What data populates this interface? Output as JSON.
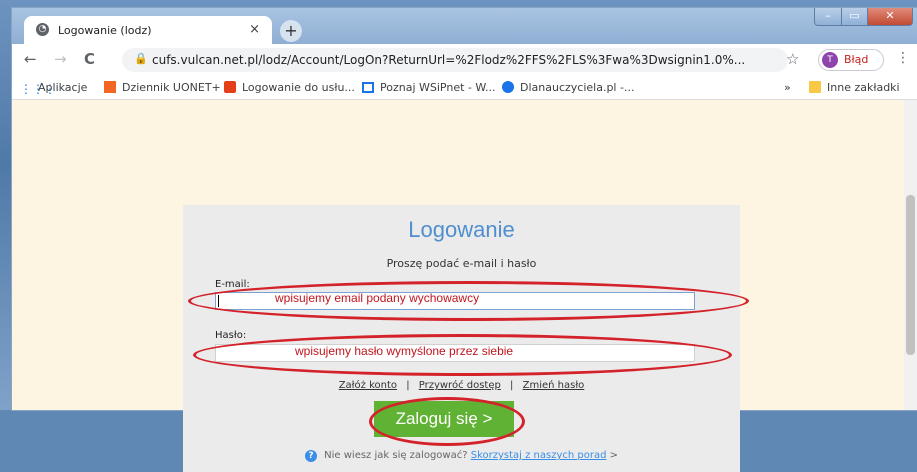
{
  "tab": {
    "title": "Logowanie (lodz)",
    "close": "×",
    "new": "+"
  },
  "window": {
    "min": "–",
    "max": "▭",
    "close": "✕"
  },
  "nav": {
    "back": "←",
    "forward": "→",
    "reload": "C"
  },
  "address": {
    "url": "cufs.vulcan.net.pl/lodz/Account/LogOn?ReturnUrl=%2Flodz%2FFS%2FLS%3Fwa%3Dwsignin1.0%..."
  },
  "profile": {
    "initial": "T",
    "label": "Błąd"
  },
  "bookmarks": {
    "items": [
      {
        "label": "Aplikacje",
        "icon": "apps-grid-icon"
      },
      {
        "label": "Dziennik UONET+",
        "icon": "uonet-icon"
      },
      {
        "label": "Logowanie do usłu...",
        "icon": "office-icon"
      },
      {
        "label": "Poznaj WSiPnet - W...",
        "icon": "monitor-icon"
      },
      {
        "label": "Dlanauczyciela.pl -...",
        "icon": "globe-icon"
      }
    ],
    "more": "»",
    "other": "Inne zakładki"
  },
  "login": {
    "title": "Logowanie",
    "subtitle": "Proszę podać e-mail i hasło",
    "email_label": "E-mail:",
    "email_hint": "wpisujemy email podany wychowawcy",
    "password_label": "Hasło:",
    "password_hint": "wpisujemy hasło wymyślone przez siebie",
    "links": [
      "Załóż konto",
      "Przywróć dostęp",
      "Zmień hasło"
    ],
    "sep": "|",
    "button": "Zaloguj się >",
    "help_q": "?",
    "help_text": "Nie wiesz jak się zalogować?",
    "help_link": "Skorzystaj z naszych porad",
    "help_arrow": ">"
  },
  "colors": {
    "accent": "#4f8fcf",
    "button": "#5fb233",
    "annotation": "#d4222b",
    "page_bg": "#fdf5e2"
  }
}
